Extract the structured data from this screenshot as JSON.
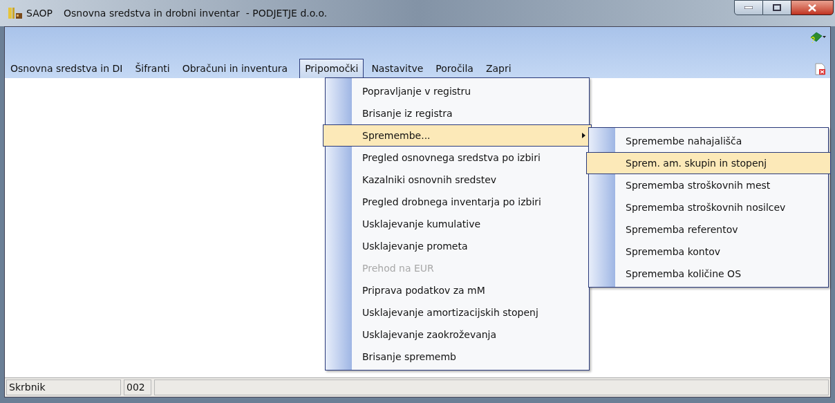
{
  "window": {
    "app": "SAOP",
    "title": "Osnovna sredstva in drobni inventar  - PODJETJE d.o.o."
  },
  "menubar": [
    {
      "label": "Osnovna sredstva in DI",
      "selected": false
    },
    {
      "label": "Šifranti",
      "selected": false
    },
    {
      "label": "Obračuni in inventura",
      "selected": false
    },
    {
      "label": "Pripomočki",
      "selected": true
    },
    {
      "label": "Nastavitve",
      "selected": false
    },
    {
      "label": "Poročila",
      "selected": false
    },
    {
      "label": "Zapri",
      "selected": false
    }
  ],
  "menu": [
    {
      "label": "Popravljanje v registru",
      "selected": false,
      "disabled": false,
      "submenu": false
    },
    {
      "label": "Brisanje iz registra",
      "selected": false,
      "disabled": false,
      "submenu": false
    },
    {
      "label": "Spremembe...",
      "selected": true,
      "disabled": false,
      "submenu": true
    },
    {
      "label": "Pregled osnovnega sredstva po izbiri",
      "selected": false,
      "disabled": false,
      "submenu": false
    },
    {
      "label": "Kazalniki osnovnih sredstev",
      "selected": false,
      "disabled": false,
      "submenu": false
    },
    {
      "label": "Pregled drobnega inventarja po izbiri",
      "selected": false,
      "disabled": false,
      "submenu": false
    },
    {
      "label": "Usklajevanje kumulative",
      "selected": false,
      "disabled": false,
      "submenu": false
    },
    {
      "label": "Usklajevanje prometa",
      "selected": false,
      "disabled": false,
      "submenu": false
    },
    {
      "label": "Prehod na EUR",
      "selected": false,
      "disabled": true,
      "submenu": false
    },
    {
      "label": "Priprava podatkov za mM",
      "selected": false,
      "disabled": false,
      "submenu": false
    },
    {
      "label": "Usklajevanje amortizacijskih stopenj",
      "selected": false,
      "disabled": false,
      "submenu": false
    },
    {
      "label": "Usklajevanje zaokroževanja",
      "selected": false,
      "disabled": false,
      "submenu": false
    },
    {
      "label": "Brisanje sprememb",
      "selected": false,
      "disabled": false,
      "submenu": false
    }
  ],
  "submenu": [
    {
      "label": "Spremembe nahajališča",
      "selected": false
    },
    {
      "label": "Sprem. am. skupin in stopenj",
      "selected": true
    },
    {
      "label": "Sprememba stroškovnih mest",
      "selected": false
    },
    {
      "label": "Sprememba stroškovnih nosilcev",
      "selected": false
    },
    {
      "label": "Sprememba referentov",
      "selected": false
    },
    {
      "label": "Sprememba kontov",
      "selected": false
    },
    {
      "label": "Sprememba količine OS",
      "selected": false
    }
  ],
  "status_bar": [
    "Skrbnik",
    "002"
  ]
}
